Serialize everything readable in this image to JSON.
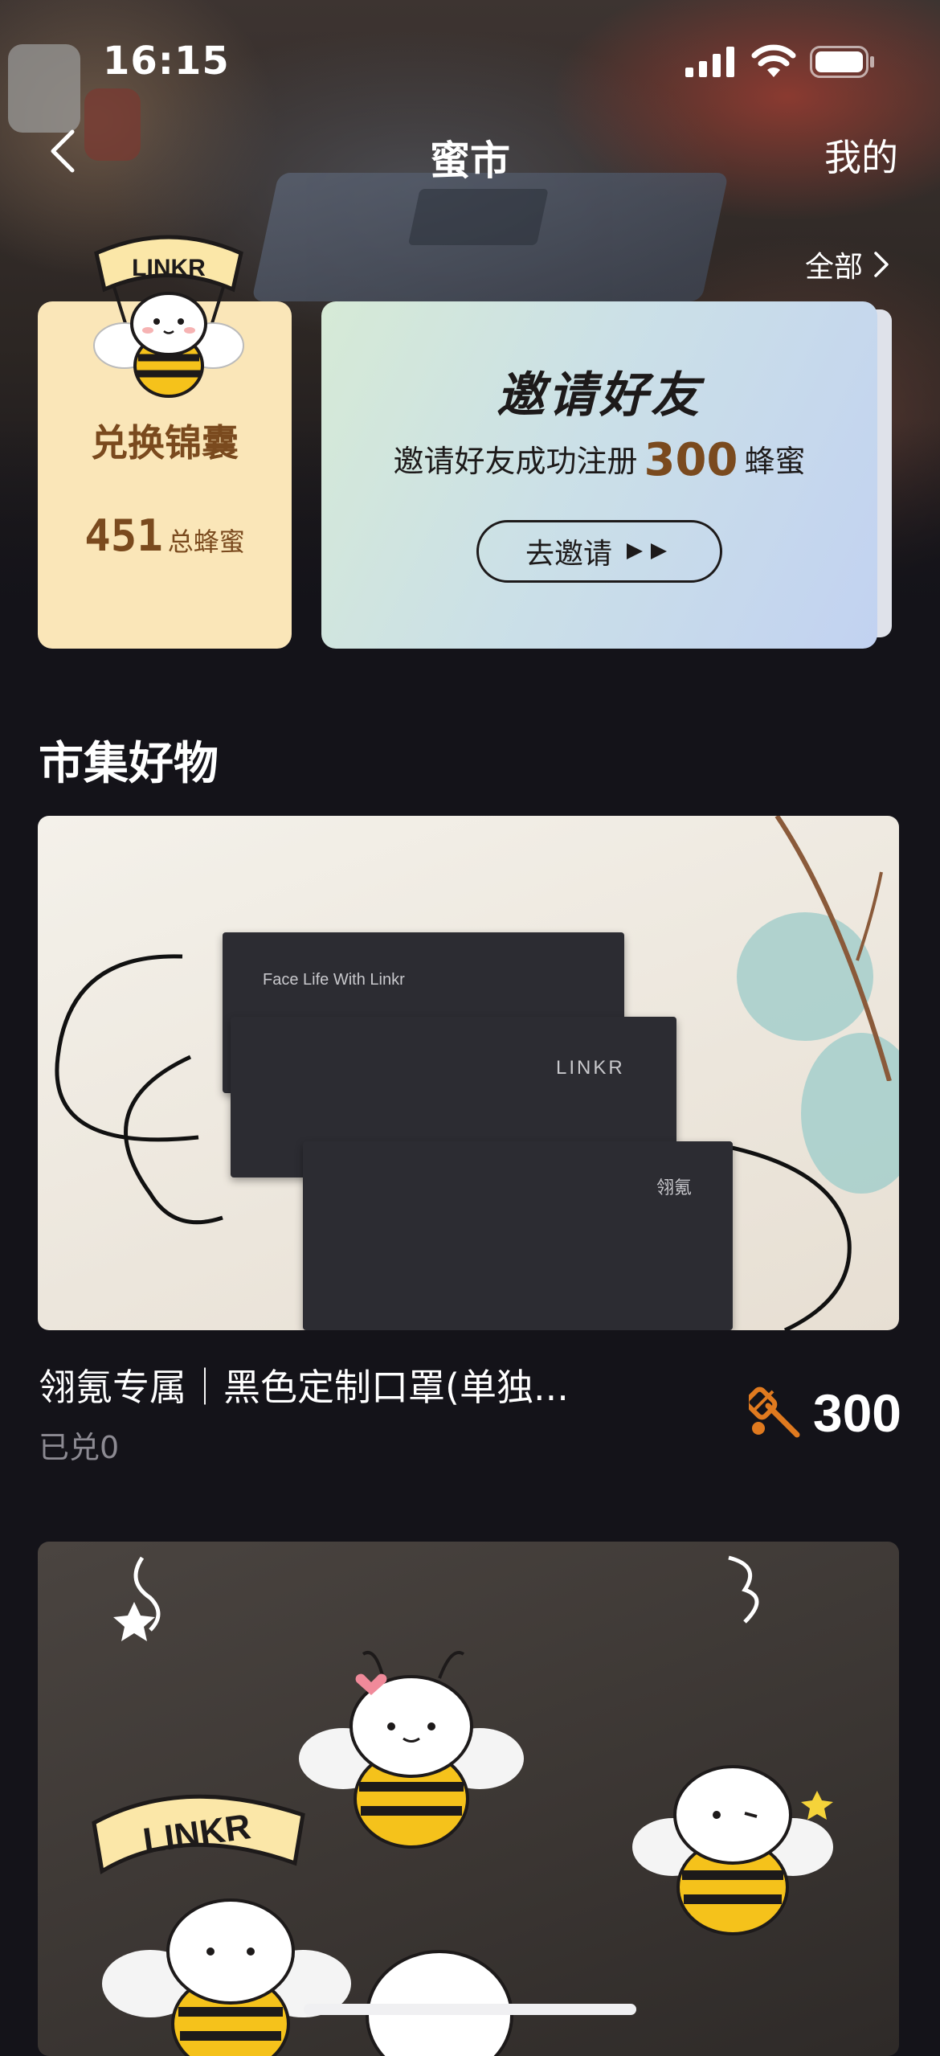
{
  "status_bar": {
    "time": "16:15"
  },
  "nav": {
    "title": "蜜市",
    "right_label": "我的"
  },
  "banner": {
    "see_all_label": "全部"
  },
  "redeem_card": {
    "mascot_text": "LINKR",
    "title": "兑换锦囊",
    "total_honey": "451",
    "total_honey_label": "总蜂蜜"
  },
  "invite_card": {
    "title": "邀请好友",
    "desc_prefix": "邀请好友成功注册",
    "reward_amount": "300",
    "desc_suffix": "蜂蜜",
    "button_label": "去邀请"
  },
  "market": {
    "section_title": "市集好物",
    "products": [
      {
        "name": "翎氪专属｜黑色定制口罩(单独...",
        "sold_label": "已兑0",
        "price": "300",
        "image_texts": [
          "Face Life With Linkr",
          "LINKR",
          "翎氪"
        ]
      },
      {
        "image_texts": [
          "LINKR"
        ]
      }
    ]
  },
  "colors": {
    "background": "#141319",
    "card_brown": "#7a4a1e",
    "honey_orange": "#e07a1f"
  },
  "icons": [
    "back-icon",
    "signal-icon",
    "wifi-icon",
    "battery-icon",
    "chevron-right-icon",
    "play-arrows-icon",
    "honey-dipper-icon"
  ]
}
